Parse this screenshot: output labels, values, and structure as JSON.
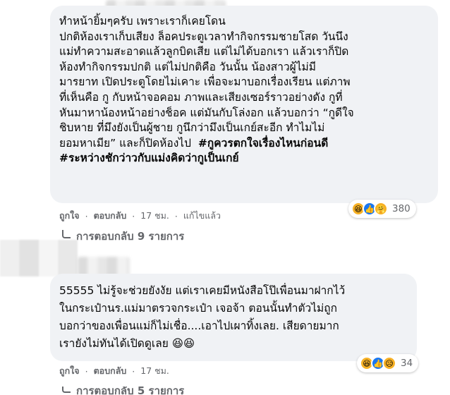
{
  "comments": [
    {
      "lines": [
        "ทำหน้ายิ้มๆครับ เพราะเราก็เคยโดน",
        "ปกติห้องเราเก็บเสียง ล็อคประตูเวลาทำกิจกรรมชายโสด วันนึง",
        "แม่ทำความสะอาดแล้วลูกบิดเสีย แต่ไม่ได้บอกเรา แล้วเราก็ปิด",
        "ห้องทำกิจกรรมปกติ แต่ไม่ปกติคือ วันนั้น น้องสาวผู้ไม่มี",
        "มารยาท เปิดประตูโดยไม่เคาะ เพื่อจะมาบอกเรื่องเรียน แต่ภาพ",
        "ที่เห็นคือ กู กับหน้าจอคอม ภาพและเสียงเซอร์ราวอย่างดัง กูที่",
        "หันมาหาน้องหน้าอย่างช็อค แต่มันกับโล่งอก แล้วบอกว่า “กูดีใจ",
        "ชิบหาย ที่มึงยังเป็นผู้ชาย กูนึกว่ามึงเป็นเกย์สะอีก ทำไมไม่",
        "ยอมหาเมีย” และก็ปิดห้องไป"
      ],
      "hashtags": [
        "#กูควรตกใจเรื่องไหนก่อนดี",
        "#ระหว่างชักว่าวกับแม่งคิดว่ากูเป็นเกย์"
      ],
      "reaction_count": "380",
      "reactions": [
        "haha-icon",
        "like-icon",
        "care-icon"
      ],
      "actions": {
        "like": "ถูกใจ",
        "reply": "ตอบกลับ",
        "time": "17 ชม.",
        "edited": "แก้ไขแล้ว"
      },
      "replies_label": "การตอบกลับ 9 รายการ"
    },
    {
      "lines": [
        "55555 ไม่รู้จะช่วยยังงัย แต่เราเคยมีหนังสือโป๊เพื่อนมาฝากไว้",
        "ในกระเป๋านร.แม่มาตรวจกระเป๋า เจอจ้า ตอนนั้นทำตัวไม่ถูก",
        "บอกว่าของเพื่อนแม่ก็ไม่เชื่อ....เอาไปเผาทิ้งเลย. เสียดายมาก",
        "เรายังไม่ทันได้เปิดดูเลย 😆😆"
      ],
      "reaction_count": "34",
      "reactions": [
        "haha-icon",
        "like-icon",
        "sad-icon"
      ],
      "actions": {
        "like": "ถูกใจ",
        "reply": "ตอบกลับ",
        "time": "17 ชม."
      },
      "replies_label": "การตอบกลับ 5 รายการ"
    }
  ],
  "separator": "·",
  "colors": {
    "bubble": "#f0f2f5",
    "meta": "#65676b",
    "text": "#050505",
    "like_blue": "#1877f2",
    "haha_yellow": "#f7b125"
  }
}
